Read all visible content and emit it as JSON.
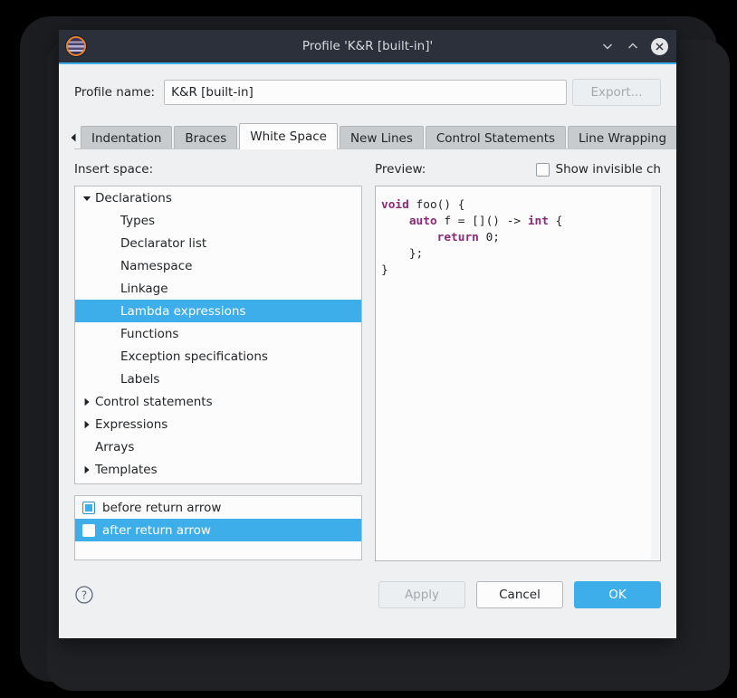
{
  "window": {
    "title": "Profile 'K&R [built-in]'",
    "icon": "app-icon",
    "minimize_icon": "chevron-down-icon",
    "maximize_icon": "chevron-up-icon",
    "close_icon": "close-icon"
  },
  "profile": {
    "label": "Profile name:",
    "value": "K&R [built-in]",
    "placeholder": "",
    "export_label": "Export..."
  },
  "tabs": {
    "scroll_left_icon": "triangle-left-icon",
    "scroll_right_icon": "triangle-right-icon",
    "items": [
      {
        "label": "Indentation",
        "active": false
      },
      {
        "label": "Braces",
        "active": false
      },
      {
        "label": "White Space",
        "active": true
      },
      {
        "label": "New Lines",
        "active": false
      },
      {
        "label": "Control Statements",
        "active": false
      },
      {
        "label": "Line Wrapping",
        "active": false
      }
    ]
  },
  "left_pane": {
    "label": "Insert space:",
    "tree": [
      {
        "label": "Declarations",
        "level": 0,
        "arrow": "down",
        "selected": false
      },
      {
        "label": "Types",
        "level": 1,
        "arrow": "none",
        "selected": false
      },
      {
        "label": "Declarator list",
        "level": 1,
        "arrow": "none",
        "selected": false
      },
      {
        "label": "Namespace",
        "level": 1,
        "arrow": "none",
        "selected": false
      },
      {
        "label": "Linkage",
        "level": 1,
        "arrow": "none",
        "selected": false
      },
      {
        "label": "Lambda expressions",
        "level": 1,
        "arrow": "none",
        "selected": true
      },
      {
        "label": "Functions",
        "level": 1,
        "arrow": "none",
        "selected": false
      },
      {
        "label": "Exception specifications",
        "level": 1,
        "arrow": "none",
        "selected": false
      },
      {
        "label": "Labels",
        "level": 1,
        "arrow": "none",
        "selected": false
      },
      {
        "label": "Control statements",
        "level": 0,
        "arrow": "right",
        "selected": false
      },
      {
        "label": "Expressions",
        "level": 0,
        "arrow": "right",
        "selected": false
      },
      {
        "label": "Arrays",
        "level": 0,
        "arrow": "none",
        "selected": false
      },
      {
        "label": "Templates",
        "level": 0,
        "arrow": "right",
        "selected": false
      }
    ],
    "options": [
      {
        "label": "before return arrow",
        "checked": true,
        "selected": false
      },
      {
        "label": "after return arrow",
        "checked": false,
        "selected": true
      }
    ]
  },
  "right_pane": {
    "label": "Preview:",
    "show_invisible_label": "Show invisible ch",
    "show_invisible_checked": false,
    "code_lines": [
      [
        {
          "t": "void",
          "k": true
        },
        {
          "t": " foo() {",
          "k": false
        }
      ],
      [
        {
          "t": "    ",
          "k": false
        },
        {
          "t": "auto",
          "k": true
        },
        {
          "t": " f = []() -> ",
          "k": false
        },
        {
          "t": "int",
          "k": true
        },
        {
          "t": " {",
          "k": false
        }
      ],
      [
        {
          "t": "        ",
          "k": false
        },
        {
          "t": "return",
          "k": true
        },
        {
          "t": " 0;",
          "k": false
        }
      ],
      [
        {
          "t": "    };",
          "k": false
        }
      ],
      [
        {
          "t": "}",
          "k": false
        }
      ]
    ]
  },
  "footer": {
    "help_icon": "help-icon",
    "apply_label": "Apply",
    "cancel_label": "Cancel",
    "ok_label": "OK"
  },
  "colors": {
    "accent": "#3daee9",
    "titlebar": "#2b303b",
    "dialog_bg": "#eff0f1",
    "keyword": "#8a2a78"
  }
}
